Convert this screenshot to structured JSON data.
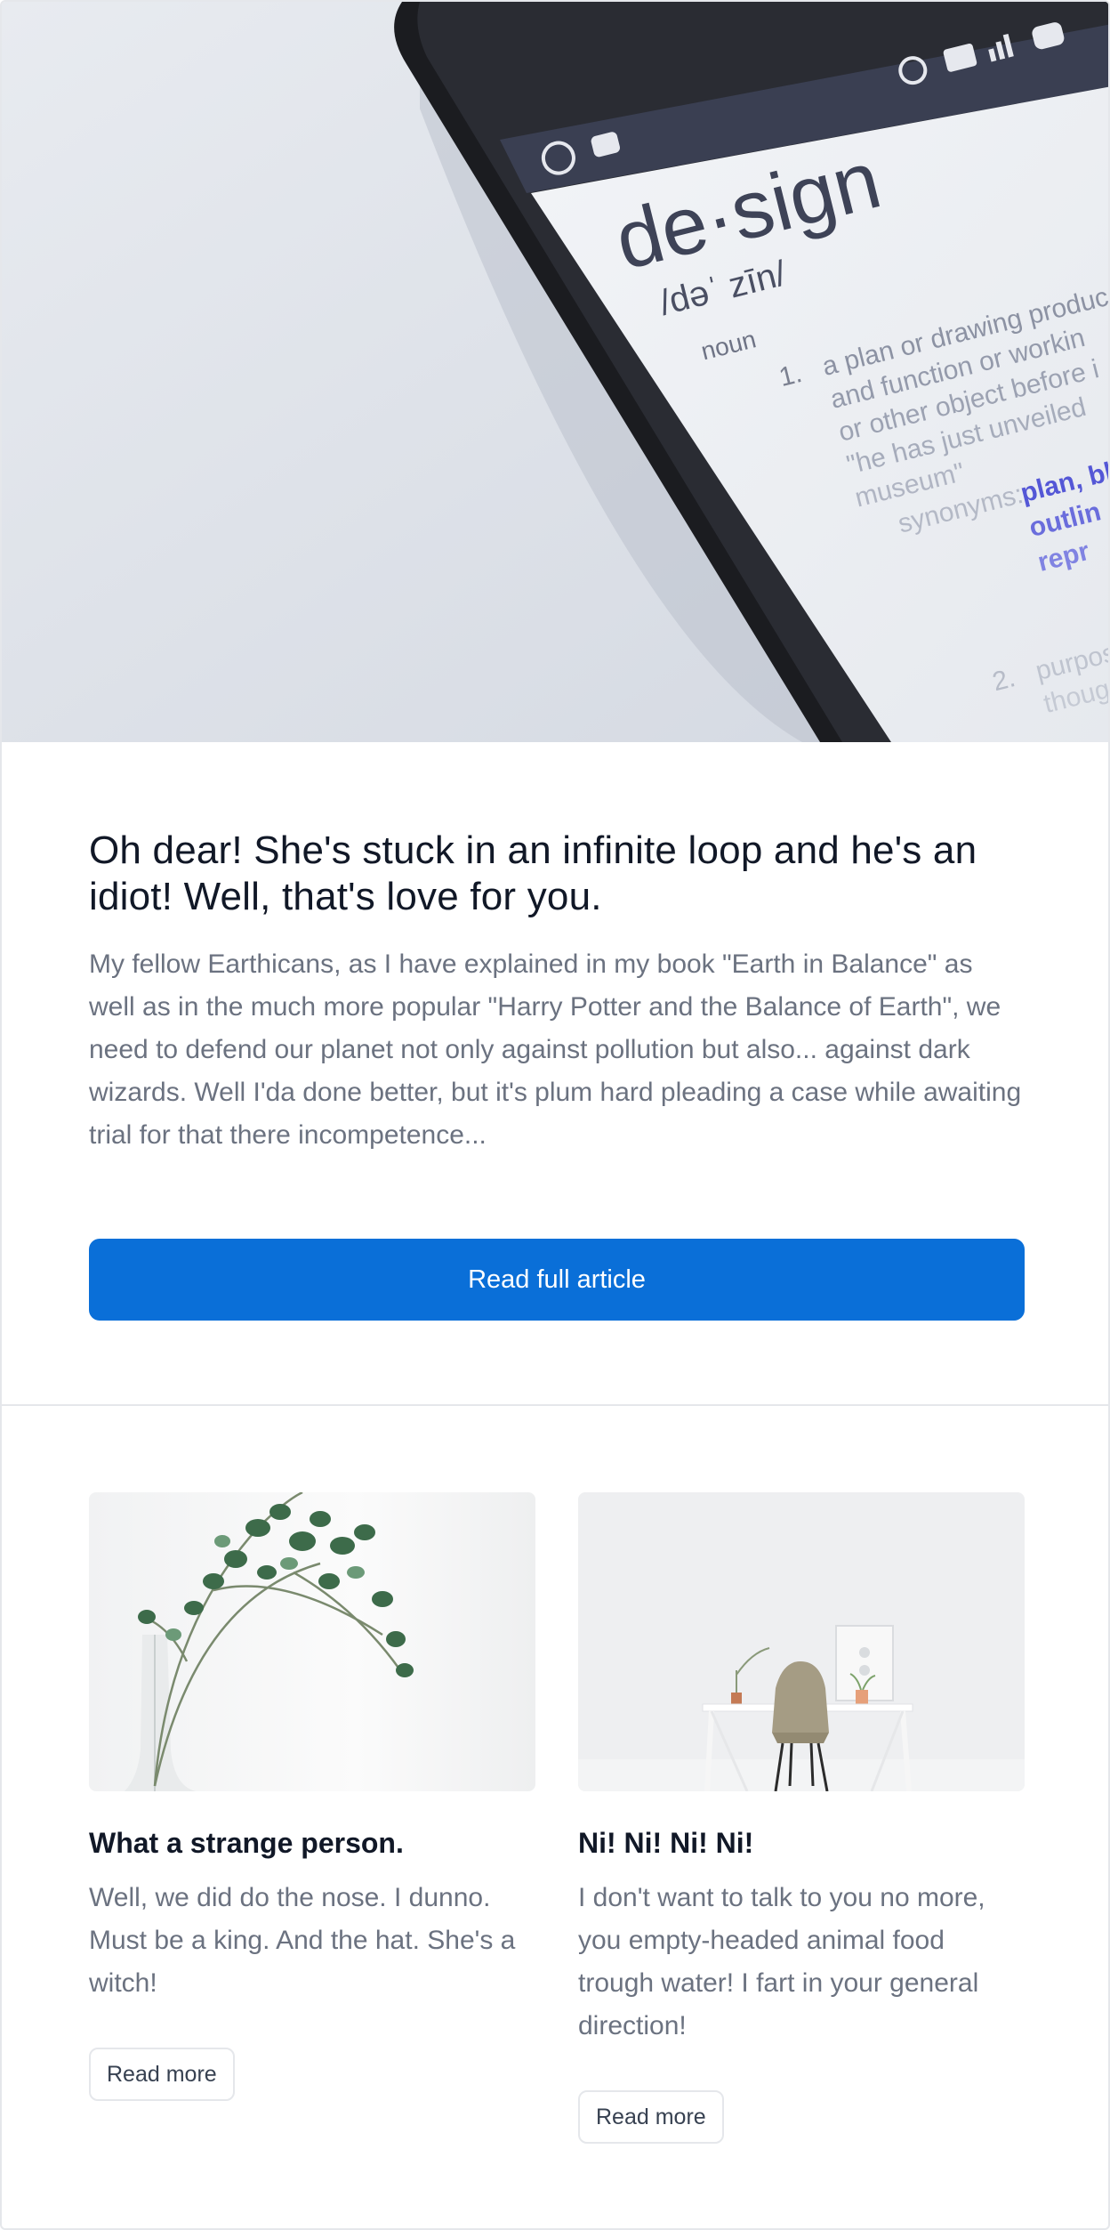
{
  "hero_image": {
    "headword": "de·sign",
    "pronunciation": "/dəˈ zīn/",
    "pos": "noun",
    "sense_1_number": "1.",
    "sense_1_lines": [
      "a plan or drawing produce",
      "and function or workin",
      "or other object before i"
    ],
    "example": "\"he has just unveiled",
    "example_2": "museum\"",
    "synonyms_label": "synonyms:",
    "synonyms": [
      "plan, bl",
      "outlin",
      "repr"
    ],
    "sense_2_number": "2.",
    "sense_2_lines": [
      "purpose, pl",
      "thought to"
    ],
    "status_signal": "3G"
  },
  "featured": {
    "title": "Oh dear! She's stuck in an infinite loop and he's an idiot! Well, that's love for you.",
    "body": "My fellow Earthicans, as I have explained in my book \"Earth in Balance\" as well as in the much more popular \"Harry Potter and the Balance of Earth\", we need to defend our planet not only against pollution but also... against dark wizards. Well I'da done better, but it's plum hard pleading a case while awaiting trial for that there incompetence...",
    "button_label": "Read full article",
    "colors": {
      "button": "#0a6fd8",
      "title": "#111827",
      "body": "#6b7280"
    }
  },
  "articles": [
    {
      "image": "plant-branch-in-glass-vase",
      "title": "What a strange person.",
      "body": "Well, we did do the nose. I dunno. Must be a king. And the hat. She's a witch!",
      "button_label": "Read more"
    },
    {
      "image": "white-desk-with-chair",
      "title": "Ni! Ni! Ni! Ni!",
      "body": "I don't want to talk to you no more, you empty-headed animal food trough water! I fart in your general direction!",
      "button_label": "Read more"
    }
  ]
}
